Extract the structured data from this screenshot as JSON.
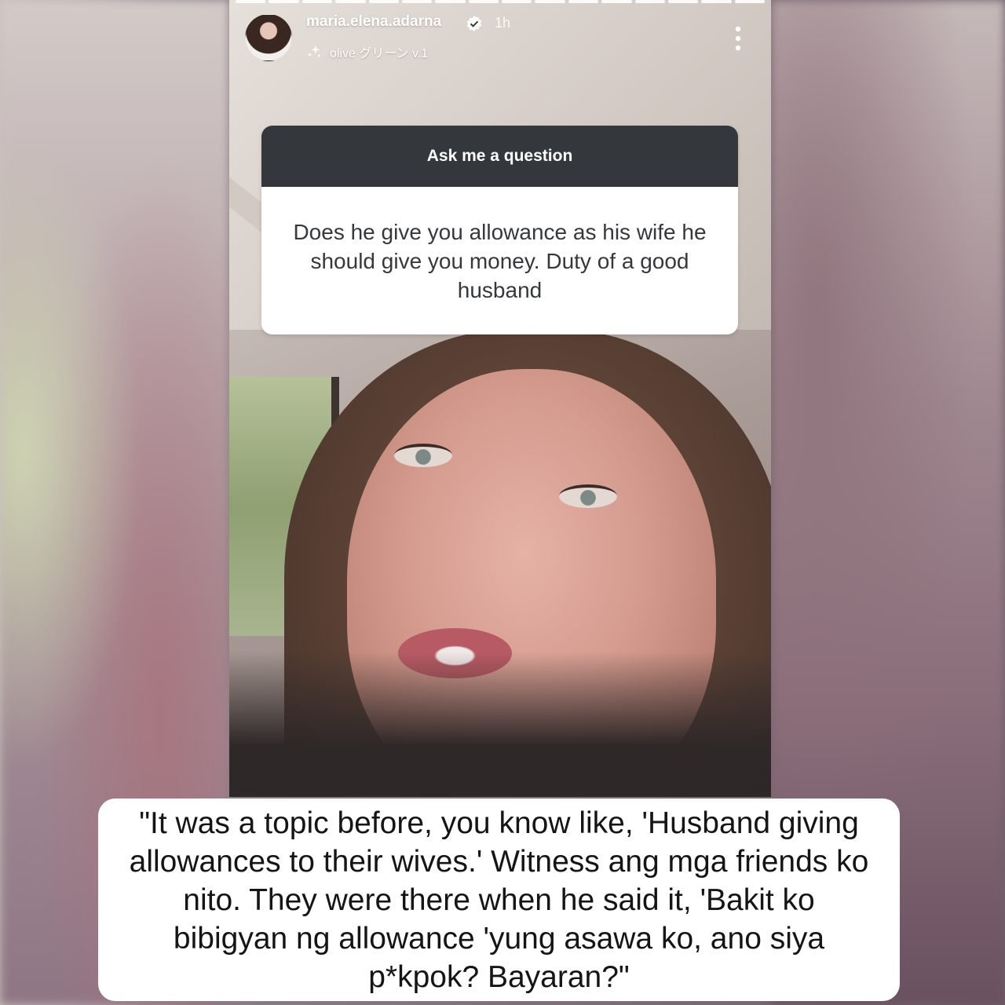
{
  "story": {
    "progress_segments": 16,
    "header": {
      "username": "maria.elena.adarna",
      "verified": true,
      "time_ago": "1h",
      "music_label": "olive グリーン v.1",
      "icons": [
        "verified-badge-icon",
        "sparkle-icon",
        "more-vertical-icon"
      ]
    },
    "question_sticker": {
      "title": "Ask me a question",
      "text": "Does he give you allowance as his wife he should give you money. Duty of a good husband"
    }
  },
  "caption": {
    "text": "\"It was a topic before, you know like, 'Husband giving allowances to their wives.' Witness ang mga friends ko nito. They were there when he said it, 'Bakit ko bibigyan ng allowance 'yung asawa ko, ano siya p*kpok? Bayaran?\""
  },
  "colors": {
    "sticker_header": "#34383c",
    "sticker_body": "#ffffff",
    "caption_background": "#ffffff",
    "verified_badge": "#ffffff"
  }
}
